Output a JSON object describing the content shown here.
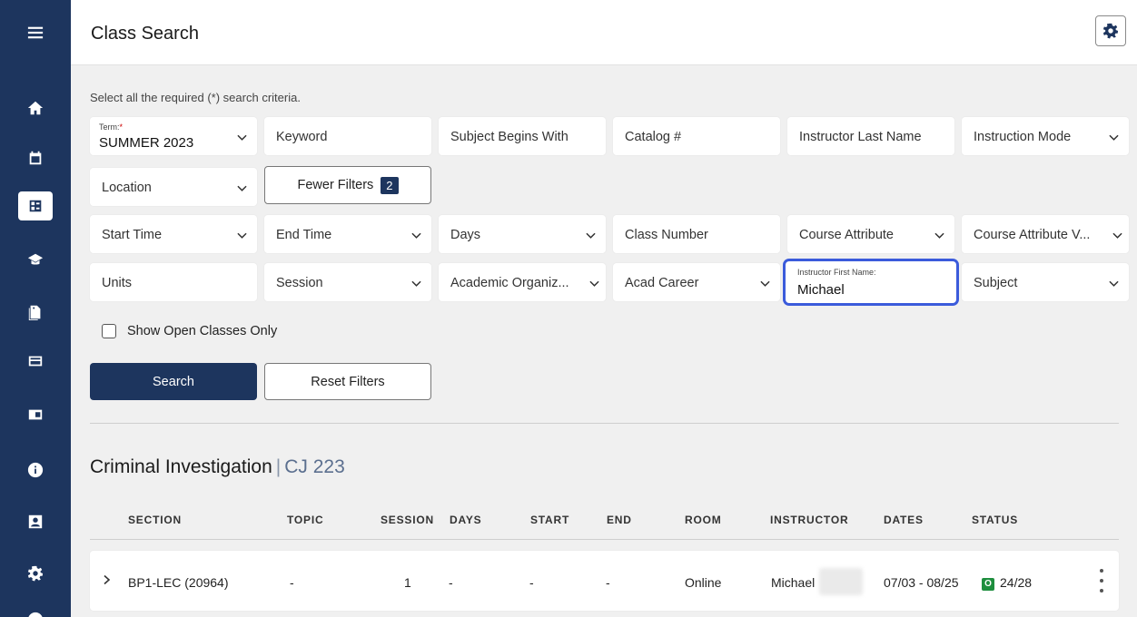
{
  "header": {
    "title": "Class Search"
  },
  "instructions": "Select all the required (*) search criteria.",
  "term": {
    "label": "Term:",
    "required_mark": "*",
    "value": "SUMMER 2023"
  },
  "filters_row1": {
    "keyword": "Keyword",
    "subject_begins": "Subject Begins With",
    "catalog": "Catalog #",
    "instructor_last": "Instructor Last Name",
    "instruction_mode": "Instruction Mode"
  },
  "filters_row2": {
    "location": "Location",
    "fewer_filters": "Fewer Filters",
    "fewer_filters_count": "2"
  },
  "filters_row3": {
    "start_time": "Start Time",
    "end_time": "End Time",
    "days": "Days",
    "class_number": "Class Number",
    "course_attribute": "Course Attribute",
    "course_attribute_value": "Course Attribute V..."
  },
  "filters_row4": {
    "units": "Units",
    "session": "Session",
    "academic_org": "Academic Organiz...",
    "acad_career": "Acad Career",
    "instructor_first_label": "Instructor First Name:",
    "instructor_first_value": "Michael",
    "subject": "Subject"
  },
  "open_only": "Show Open Classes Only",
  "buttons": {
    "search": "Search",
    "reset": "Reset Filters"
  },
  "course": {
    "name": "Criminal Investigation",
    "separator": "|",
    "code": "CJ 223"
  },
  "table": {
    "headers": [
      "SECTION",
      "TOPIC",
      "SESSION",
      "DAYS",
      "START",
      "END",
      "ROOM",
      "INSTRUCTOR",
      "DATES",
      "STATUS"
    ],
    "row": {
      "section": "BP1-LEC (20964)",
      "topic": "-",
      "session": "1",
      "days": "-",
      "start": "-",
      "end": "-",
      "room": "Online",
      "instructor": "Michael",
      "dates": "07/03 - 08/25",
      "status_code": "O",
      "status": "24/28"
    }
  },
  "colors": {
    "navy": "#1d355e",
    "focus": "#3b5bdb",
    "open_green": "#1e8e3e"
  }
}
